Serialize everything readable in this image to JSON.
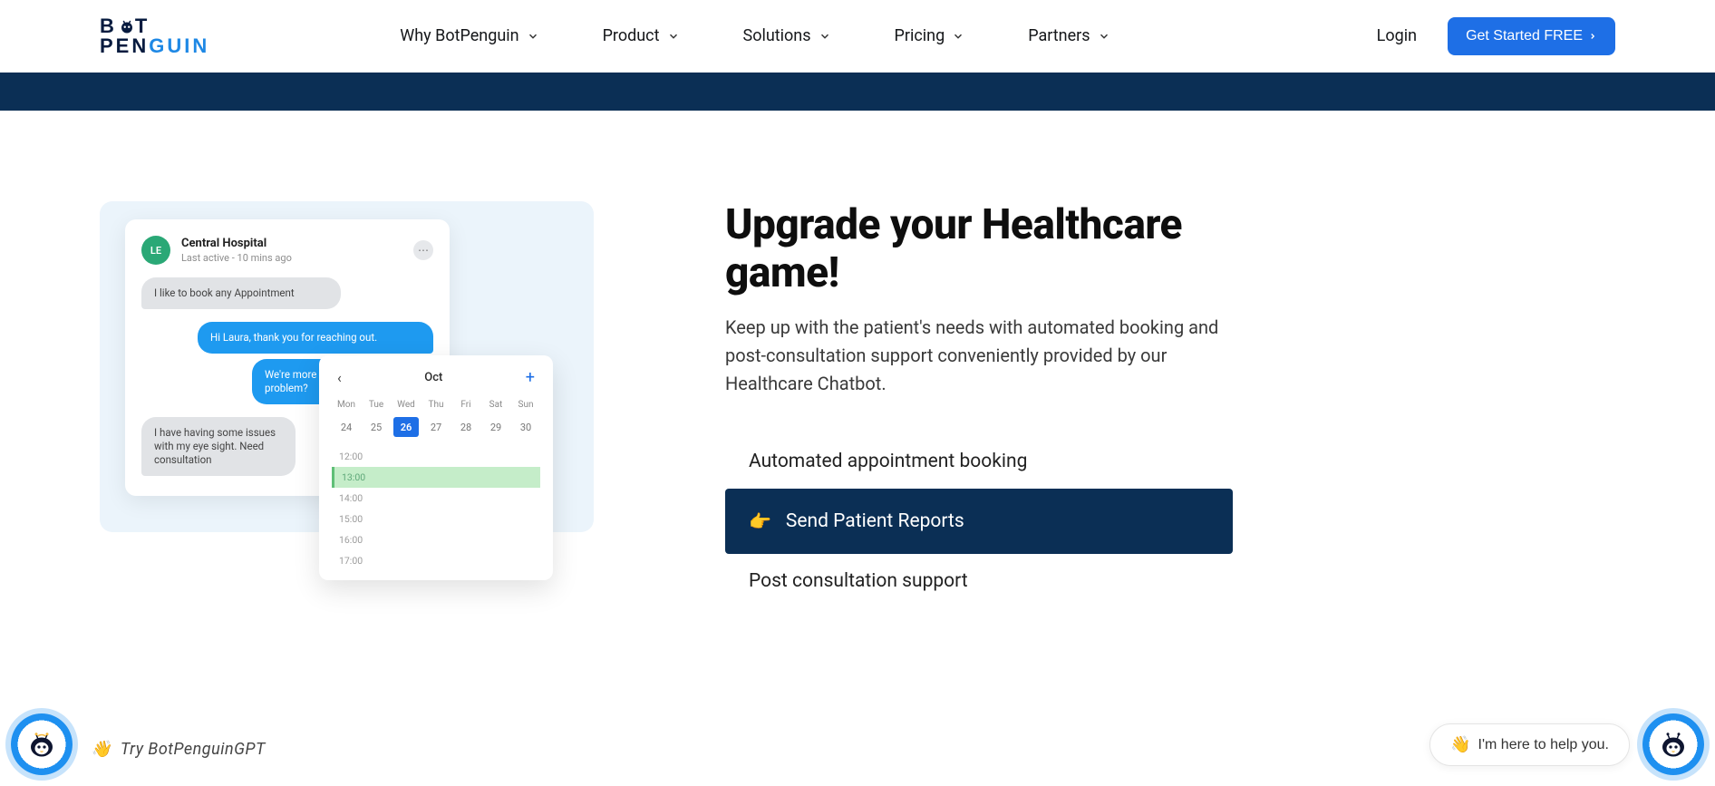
{
  "logo": {
    "top": "B   T",
    "pen": "PEN",
    "guin": "GUIN"
  },
  "nav": {
    "items": [
      {
        "label": "Why BotPenguin"
      },
      {
        "label": "Product"
      },
      {
        "label": "Solutions"
      },
      {
        "label": "Pricing"
      },
      {
        "label": "Partners"
      }
    ],
    "login": "Login",
    "cta": "Get Started FREE"
  },
  "content": {
    "heading": "Upgrade your Healthcare game!",
    "lead": "Keep up with the patient's needs with automated booking and post-consultation support conveniently provided by our Healthcare Chatbot.",
    "options": [
      {
        "label": "Automated appointment booking"
      },
      {
        "label": "Send Patient Reports"
      },
      {
        "label": "Post consultation support"
      }
    ]
  },
  "chat": {
    "avatar_initials": "LE",
    "title": "Central Hospital",
    "subtitle": "Last active - 10 mins ago",
    "msg1": "I like to book any Appointment",
    "msg2": "Hi Laura, thank you for reaching out.",
    "msg3": "We're more than happy to help, problem?",
    "msg4": "I have having some issues with my eye sight. Need consultation"
  },
  "calendar": {
    "month": "Oct",
    "dow": [
      "Mon",
      "Tue",
      "Wed",
      "Thu",
      "Fri",
      "Sat",
      "Sun"
    ],
    "days": [
      "24",
      "25",
      "26",
      "27",
      "28",
      "29",
      "30"
    ],
    "selected": "26",
    "times": [
      "12:00",
      "13:00",
      "14:00",
      "15:00",
      "16:00",
      "17:00"
    ],
    "highlighted_time": "13:00"
  },
  "widgets": {
    "try_gpt": "Try BotPenguinGPT",
    "help_text": "I'm here to help you."
  },
  "icons": {
    "wave": "👋",
    "point_right": "👉"
  }
}
